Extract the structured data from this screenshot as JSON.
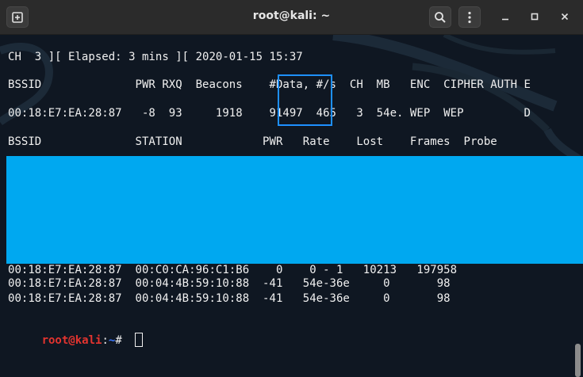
{
  "window": {
    "title": "root@kali: ~"
  },
  "terminal": {
    "status_line": "CH  3 ][ Elapsed: 3 mins ][ 2020-01-15 15:37",
    "ap_header": "BSSID              PWR RXQ  Beacons    #Data, #/s  CH  MB   ENC  CIPHER AUTH E",
    "ap_row": "00:18:E7:EA:28:87   -8  93     1918    91497  465   3  54e. WEP  WEP         D",
    "station_header": "BSSID              STATION            PWR   Rate    Lost    Frames  Probe",
    "stations": [
      "00:18:E7:EA:28:87  00:C0:CA:96:C1:B6    0    0 - 1   10213   197958",
      "00:18:E7:EA:28:87  00:04:4B:59:10:88  -41   54e-36e     0       98",
      "00:18:E7:EA:28:87  00:04:4B:59:10:88  -41   54e-36e     0       98"
    ],
    "prompt": {
      "user_host": "root@kali",
      "separator": ":",
      "path": "~",
      "symbol": "# "
    }
  },
  "colors": {
    "highlight_box": "#1e90ff",
    "redaction": "#00a8f0",
    "prompt_user": "#e3342f",
    "prompt_path": "#3b78ff"
  },
  "icons": [
    "new-tab-icon",
    "search-icon",
    "kebab-menu-icon",
    "minimize-icon",
    "maximize-icon",
    "close-icon"
  ]
}
